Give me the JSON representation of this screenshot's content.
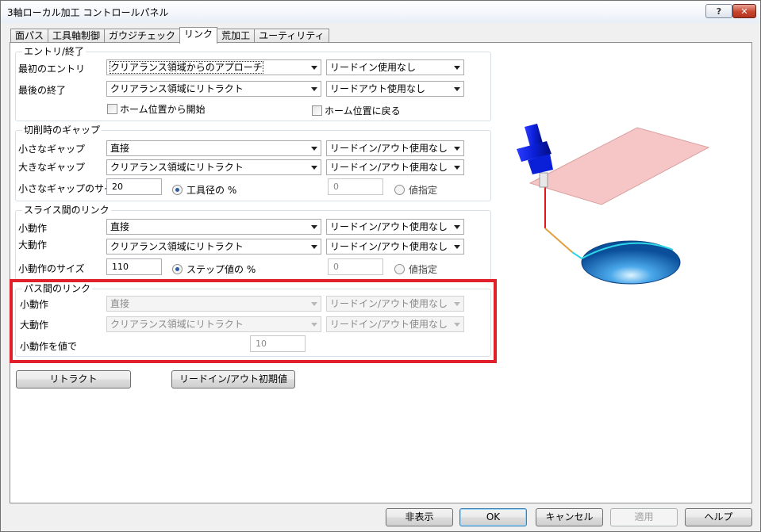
{
  "window": {
    "title": "3軸ローカル加工 コントロールパネル"
  },
  "titlebar": {
    "help_label": "?",
    "close_label": "✕"
  },
  "tabs": [
    {
      "label": "面パス",
      "active": false
    },
    {
      "label": "工具軸制御",
      "active": false
    },
    {
      "label": "ガウジチェック",
      "active": false
    },
    {
      "label": "リンク",
      "active": true
    },
    {
      "label": "荒加工",
      "active": false
    },
    {
      "label": "ユーティリティ",
      "active": false
    }
  ],
  "entry_exit": {
    "title": "エントリ/終了",
    "first_entry_label": "最初のエントリ",
    "first_entry_value": "クリアランス領域からのアプローチ",
    "first_entry_lead": "リードイン使用なし",
    "last_exit_label": "最後の終了",
    "last_exit_value": "クリアランス領域にリトラクト",
    "last_exit_lead": "リードアウト使用なし",
    "start_home_label": "ホーム位置から開始",
    "return_home_label": "ホーム位置に戻る"
  },
  "cutting_gap": {
    "title": "切削時のギャップ",
    "small_label": "小さなギャップ",
    "small_value": "直接",
    "small_lead": "リードイン/アウト使用なし",
    "large_label": "大きなギャップ",
    "large_value": "クリアランス領域にリトラクト",
    "large_lead": "リードイン/アウト使用なし",
    "size_label": "小さなギャップのサイズ",
    "size_value": "20",
    "radio1_label": "工具径の %",
    "alt_value": "0",
    "radio2_label": "値指定"
  },
  "slice_link": {
    "title": "スライス間のリンク",
    "small_label": "小動作",
    "small_value": "直接",
    "small_lead": "リードイン/アウト使用なし",
    "large_label": "大動作",
    "large_value": "クリアランス領域にリトラクト",
    "large_lead": "リードイン/アウト使用なし",
    "size_label": "小動作のサイズ",
    "size_value": "110",
    "radio1_label": "ステップ値の %",
    "alt_value": "0",
    "radio2_label": "値指定"
  },
  "pass_link": {
    "title": "パス間のリンク",
    "small_label": "小動作",
    "small_value": "直接",
    "small_lead": "リードイン/アウト使用なし",
    "large_label": "大動作",
    "large_value": "クリアランス領域にリトラクト",
    "large_lead": "リードイン/アウト使用なし",
    "value_label": "小動作を値で",
    "value": "10"
  },
  "actions": {
    "retract_label": "リトラクト",
    "lead_default_label": "リードイン/アウト初期値"
  },
  "footer": {
    "hide_label": "非表示",
    "ok_label": "OK",
    "cancel_label": "キャンセル",
    "apply_label": "適用",
    "help_label": "ヘルプ"
  },
  "colors": {
    "highlight": "#e0202a",
    "tool": "#0a1fd8",
    "stock_plane": "#f6c6c6",
    "cavity": "#1e7fd0",
    "rapid_move": "#e01818",
    "link_move": "#e0a040"
  }
}
